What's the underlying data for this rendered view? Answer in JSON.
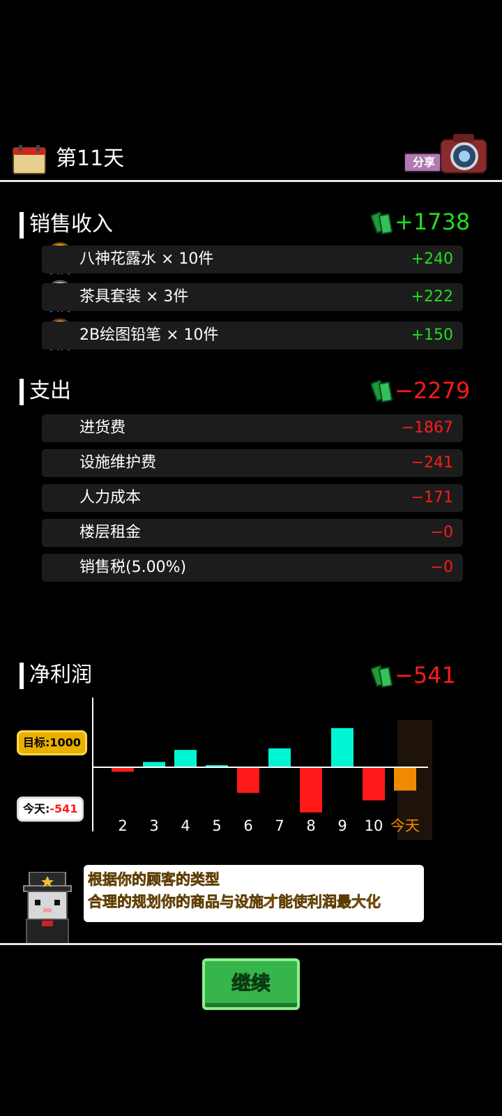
{
  "header": {
    "day_title": "第11天",
    "share_label": "分享"
  },
  "income": {
    "title": "销售收入",
    "total": "+1738",
    "items": [
      {
        "rank": "1",
        "label": "八神花露水 × 10件",
        "value": "+240"
      },
      {
        "rank": "2",
        "label": "茶具套装 × 3件",
        "value": "+222"
      },
      {
        "rank": "3",
        "label": "2B绘图铅笔 × 10件",
        "value": "+150"
      }
    ]
  },
  "expense": {
    "title": "支出",
    "total": "−2279",
    "items": [
      {
        "label": "进货费",
        "value": "−1867"
      },
      {
        "label": "设施维护费",
        "value": "−241"
      },
      {
        "label": "人力成本",
        "value": "−171"
      },
      {
        "label": "楼层租金",
        "value": "−0"
      },
      {
        "label": "销售税(5.00%)",
        "value": "−0"
      }
    ]
  },
  "net": {
    "title": "净利润",
    "total": "−541"
  },
  "chart_data": {
    "type": "bar",
    "categories": [
      "2",
      "3",
      "4",
      "5",
      "6",
      "7",
      "8",
      "9",
      "10",
      "今天"
    ],
    "values": [
      -60,
      70,
      230,
      20,
      -340,
      250,
      -600,
      520,
      -440,
      -310
    ],
    "target_label": "目标:1000",
    "today_label_prefix": "今天:",
    "today_value": "-541",
    "colors": {
      "positive": "#00f5d4",
      "negative": "#ff1a1a",
      "today": "#f08a00",
      "today_bg": "#1e130a"
    }
  },
  "tip": {
    "line1": "根据你的顾客的类型",
    "line2": "合理的规划你的商品与设施才能使利润最大化"
  },
  "continue_label": "继续"
}
